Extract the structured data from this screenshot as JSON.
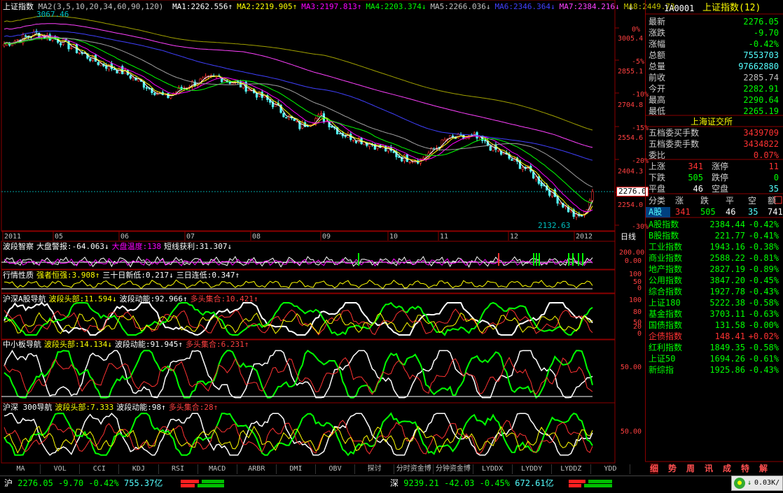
{
  "colors": {
    "up": "#ff3232",
    "down": "#54ffff",
    "green": "#00ff00",
    "yellow": "#ffff00",
    "white": "#ffffff",
    "magenta": "#ff00ff",
    "blue": "#0000ff",
    "grid": "#8b0000"
  },
  "main": {
    "title": "上证指数",
    "params": "MA2(3,5,10,20,34,60,90,120)",
    "ma": [
      {
        "label": "MA1:2262.556↑",
        "color": "#ffffff"
      },
      {
        "label": "MA2:2219.905↑",
        "color": "#ffff00"
      },
      {
        "label": "MA3:2197.813↑",
        "color": "#ff00ff"
      },
      {
        "label": "MA4:2203.374↓",
        "color": "#00ff00"
      },
      {
        "label": "MA5:2266.036↓",
        "color": "#c0c0c0"
      },
      {
        "label": "MA6:2346.364↓",
        "color": "#4040ff"
      },
      {
        "label": "MA7:2384.216↓",
        "color": "#ff40ff"
      },
      {
        "label": "MA8:2449.73",
        "color": "#c0c000"
      }
    ],
    "high_label": "3067.46",
    "low_label": "2132.63",
    "price_ticks": [
      "3005.4",
      "2855.1",
      "2704.8",
      "2554.6",
      "2404.3",
      "2254.0"
    ],
    "pct_ticks": [
      "0%",
      "-5%",
      "-10%",
      "-15%",
      "-20%",
      "-25%",
      "-30%"
    ],
    "current_tag": "2276.0",
    "period": "日线",
    "months": [
      "2011",
      "05",
      "06",
      "07",
      "08",
      "09",
      "10",
      "11",
      "12",
      "2012"
    ]
  },
  "panels": [
    {
      "title": "波段智察",
      "items": [
        {
          "t": "大盘警报:-64.063↓",
          "c": "#ffffff"
        },
        {
          "t": "大盘温度:138",
          "c": "#ff00ff"
        },
        {
          "t": "短线获利:31.307↓",
          "c": "#ffffff"
        }
      ],
      "ticks": [
        "200.00",
        "0.00"
      ]
    },
    {
      "title": "行情性质",
      "items": [
        {
          "t": "强者恒强:3.908↑",
          "c": "#ffff00"
        },
        {
          "t": "三十日新低:0.217↓",
          "c": "#ffffff"
        },
        {
          "t": "三日连低:0.347↑",
          "c": "#ffffff"
        }
      ],
      "ticks": [
        "100",
        "50",
        "0"
      ]
    },
    {
      "title": "沪深A股导航",
      "items": [
        {
          "t": "波段头部:11.594↓",
          "c": "#ffff00"
        },
        {
          "t": "波段动能:92.966↑",
          "c": "#ffffff"
        },
        {
          "t": "多头集合:10.421↑",
          "c": "#ff4040"
        }
      ],
      "ticks": [
        "100",
        "80",
        "50",
        "20",
        "0"
      ]
    },
    {
      "title": "中小板导航",
      "items": [
        {
          "t": "波段头部:14.134↓",
          "c": "#ffff00"
        },
        {
          "t": "波段动能:91.945↑",
          "c": "#ffffff"
        },
        {
          "t": "多头集合:6.231↑",
          "c": "#ff4040"
        }
      ],
      "ticks": [
        "50.00"
      ]
    },
    {
      "title": "沪深 300导航",
      "items": [
        {
          "t": "波段头部:7.333",
          "c": "#ffff00"
        },
        {
          "t": "波段动能:98↑",
          "c": "#ffffff"
        },
        {
          "t": "多头集合:28↑",
          "c": "#ff4040"
        }
      ],
      "ticks": [
        "50.00"
      ]
    }
  ],
  "right": {
    "header_code": "1A0001",
    "header_name": "上证指数(12)",
    "quote": [
      {
        "label": "最新",
        "value": "2276.05",
        "color": "#00ff00"
      },
      {
        "label": "涨跌",
        "value": "-9.70",
        "color": "#00ff00"
      },
      {
        "label": "涨幅",
        "value": "-0.42%",
        "color": "#00ff00"
      },
      {
        "label": "总额",
        "value": "7553703",
        "color": "#54ffff"
      },
      {
        "label": "总量",
        "value": "97662880",
        "color": "#54ffff"
      },
      {
        "label": "前收",
        "value": "2285.74",
        "color": "#c0c0c0"
      },
      {
        "label": "今开",
        "value": "2282.91",
        "color": "#00ff00"
      },
      {
        "label": "最高",
        "value": "2290.64",
        "color": "#00ff00"
      },
      {
        "label": "最低",
        "value": "2265.19",
        "color": "#00ff00"
      }
    ],
    "exchange": "上海证交所",
    "orders": [
      {
        "label": "五档委买手数",
        "value": "3439709",
        "color": "#ff3232"
      },
      {
        "label": "五档委卖手数",
        "value": "3434822",
        "color": "#ff3232"
      },
      {
        "label": "委比",
        "value": "0.07%",
        "color": "#ff3232"
      }
    ],
    "breadth": [
      {
        "l1": "上涨",
        "v1": "341",
        "l2": "涨停",
        "v2": "11",
        "c1": "#ff3232",
        "c2": "#ff3232"
      },
      {
        "l1": "下跌",
        "v1": "505",
        "l2": "跌停",
        "v2": "0",
        "c1": "#00ff00",
        "c2": "#00ff00"
      },
      {
        "l1": "平盘",
        "v1": "46",
        "l2": "空盘",
        "v2": "35",
        "c1": "#ffffff",
        "c2": "#54ffff"
      }
    ],
    "cls_header": {
      "c0": "分类",
      "c1": "涨",
      "c2": "跌",
      "c3": "平",
      "c4": "空",
      "c5": "额"
    },
    "cls_row": {
      "c0": "A股",
      "c1": "341",
      "c2": "505",
      "c3": "46",
      "c4": "35",
      "c5": "741"
    },
    "indices": [
      {
        "name": "A股指数",
        "value": "2384.44",
        "pct": "-0.42%",
        "color": "#00ff00"
      },
      {
        "name": "B股指数",
        "value": "221.77",
        "pct": "-0.41%",
        "color": "#00ff00"
      },
      {
        "name": "工业指数",
        "value": "1943.16",
        "pct": "-0.38%",
        "color": "#00ff00"
      },
      {
        "name": "商业指数",
        "value": "2588.22",
        "pct": "-0.81%",
        "color": "#00ff00"
      },
      {
        "name": "地产指数",
        "value": "2827.19",
        "pct": "-0.89%",
        "color": "#00ff00"
      },
      {
        "name": "公用指数",
        "value": "3847.20",
        "pct": "-0.45%",
        "color": "#00ff00"
      },
      {
        "name": "综合指数",
        "value": "1927.78",
        "pct": "-0.43%",
        "color": "#00ff00"
      },
      {
        "name": "上证180",
        "value": "5222.38",
        "pct": "-0.58%",
        "color": "#00ff00"
      },
      {
        "name": "基金指数",
        "value": "3703.11",
        "pct": "-0.63%",
        "color": "#00ff00"
      },
      {
        "name": "国债指数",
        "value": "131.58",
        "pct": "-0.00%",
        "color": "#00ff00"
      },
      {
        "name": "企债指数",
        "value": "148.41",
        "pct": "+0.02%",
        "color": "#ff3232"
      },
      {
        "name": "红利指数",
        "value": "1849.35",
        "pct": "-0.58%",
        "color": "#00ff00"
      },
      {
        "name": "上证50",
        "value": "1694.26",
        "pct": "-0.61%",
        "color": "#00ff00"
      },
      {
        "name": "新综指",
        "value": "1925.86",
        "pct": "-0.43%",
        "color": "#00ff00"
      }
    ],
    "tabs": [
      "细",
      "势",
      "周",
      "讯",
      "成",
      "特",
      "解"
    ]
  },
  "tabs": [
    "MA",
    "VOL",
    "CCI",
    "KDJ",
    "RSI",
    "MACD",
    "ARBR",
    "DMI",
    "OBV",
    "探讨",
    "分时资金博",
    "分钟资金博",
    "LYDDX",
    "LYDDY",
    "LYDDZ",
    "YDD"
  ],
  "status": {
    "sh_label": "沪",
    "sh_value": "2276.05",
    "sh_change": "-9.70",
    "sh_pct": "-0.42%",
    "sh_amount": "755.37亿",
    "sz_label": "深",
    "sz_value": "9239.21",
    "sz_change": "-42.03",
    "sz_pct": "-0.45%",
    "sz_amount": "672.61亿",
    "net": "0.03K/"
  }
}
